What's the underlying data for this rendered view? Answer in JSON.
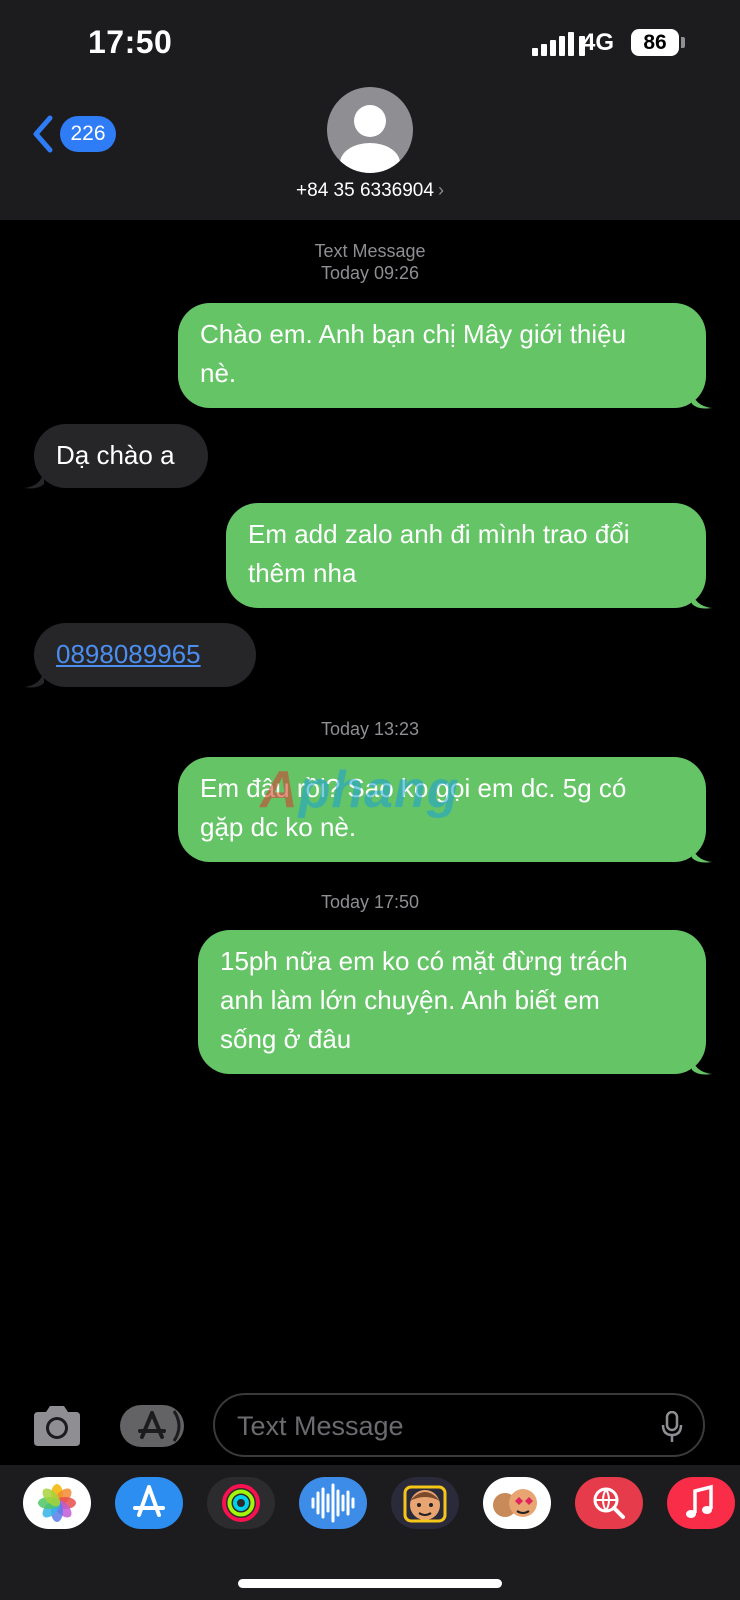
{
  "status_bar": {
    "time": "17:50",
    "network": "4G",
    "battery": "86"
  },
  "header": {
    "back_count": "226",
    "contact": "+84 35 6336904",
    "chevron": "›"
  },
  "thread": {
    "ts1_label": "Text Message",
    "ts1_time": "Today 09:26",
    "msg1": [
      "Chào em. Anh bạn chị Mây giới thiệu",
      "nè."
    ],
    "msg2": "Dạ chào a",
    "msg3": [
      "Em add zalo anh đi mình trao đổi",
      "thêm nha"
    ],
    "msg4_link": "0898089965",
    "ts2": "Today 13:23",
    "msg5": [
      "Em đâu rồi? Sao ko gọi em dc. 5g có",
      "gặp dc ko nè."
    ],
    "ts3": "Today 17:50",
    "msg6": [
      "15ph nữa em ko có mặt đừng trách",
      "anh làm lớn chuyện. Anh biết em",
      "sống ở đâu"
    ]
  },
  "watermark": {
    "part1": "A",
    "part2": "phang"
  },
  "compose": {
    "placeholder": "Text Message"
  },
  "app_drawer": {
    "apps": [
      "photos-icon",
      "app-store-icon",
      "fitness-icon",
      "voice-memo-icon",
      "memoji-icon",
      "memoji-stickers-icon",
      "image-search-icon",
      "music-icon"
    ]
  },
  "colors": {
    "outgoing": "#65c466",
    "incoming": "#262628",
    "accent": "#2e7cf6"
  }
}
